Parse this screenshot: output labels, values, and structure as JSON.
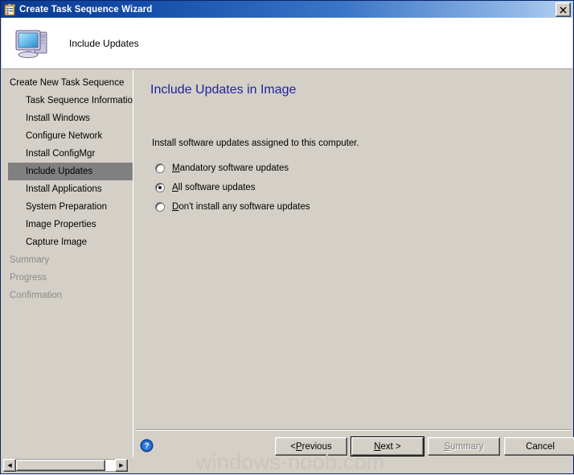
{
  "window": {
    "title": "Create Task Sequence Wizard",
    "title_icon": "task-list-clipboard-icon",
    "close_label": "✕"
  },
  "header": {
    "icon": "computer-icon",
    "title": "Include Updates"
  },
  "sidebar": {
    "items": [
      {
        "label": "Create New Task Sequence",
        "level": 0,
        "state": "normal"
      },
      {
        "label": "Task Sequence Information",
        "level": 1,
        "state": "normal"
      },
      {
        "label": "Install Windows",
        "level": 1,
        "state": "normal"
      },
      {
        "label": "Configure Network",
        "level": 1,
        "state": "normal"
      },
      {
        "label": "Install ConfigMgr",
        "level": 1,
        "state": "normal"
      },
      {
        "label": "Include Updates",
        "level": 1,
        "state": "selected"
      },
      {
        "label": "Install Applications",
        "level": 1,
        "state": "normal"
      },
      {
        "label": "System Preparation",
        "level": 1,
        "state": "normal"
      },
      {
        "label": "Image Properties",
        "level": 1,
        "state": "normal"
      },
      {
        "label": "Capture Image",
        "level": 1,
        "state": "normal"
      },
      {
        "label": "Summary",
        "level": 0,
        "state": "disabled"
      },
      {
        "label": "Progress",
        "level": 0,
        "state": "disabled"
      },
      {
        "label": "Confirmation",
        "level": 0,
        "state": "disabled"
      }
    ],
    "scrollbar": {
      "left_arrow": "◀",
      "right_arrow": "▶"
    }
  },
  "main": {
    "heading": "Include Updates in Image",
    "instruction": "Install software updates assigned to this computer.",
    "radio_options": [
      {
        "label_before": "",
        "accel": "M",
        "label_after": "andatory software updates",
        "checked": false
      },
      {
        "label_before": "",
        "accel": "A",
        "label_after": "ll software updates",
        "checked": true
      },
      {
        "label_before": "",
        "accel": "D",
        "label_after": "on't install any software updates",
        "checked": false
      }
    ]
  },
  "footer": {
    "help_icon": "help-question-icon",
    "buttons": [
      {
        "id": "previous",
        "before": "< ",
        "accel": "P",
        "after": "revious",
        "state": "normal"
      },
      {
        "id": "next",
        "before": "",
        "accel": "N",
        "after": "ext >",
        "state": "default"
      },
      {
        "id": "summary",
        "before": "",
        "accel": "S",
        "after": "ummary",
        "state": "disabled"
      },
      {
        "id": "cancel",
        "before": "Cancel",
        "accel": "",
        "after": "",
        "state": "normal"
      }
    ]
  },
  "watermark": {
    "text": "windows-noob.com"
  },
  "colors": {
    "dialog_face": "#d4d0c8",
    "heading_blue": "#22229c",
    "selection_gray": "#808080",
    "titlebar_blue": "#0b3a8f",
    "disabled_text": "#8a8a86"
  }
}
